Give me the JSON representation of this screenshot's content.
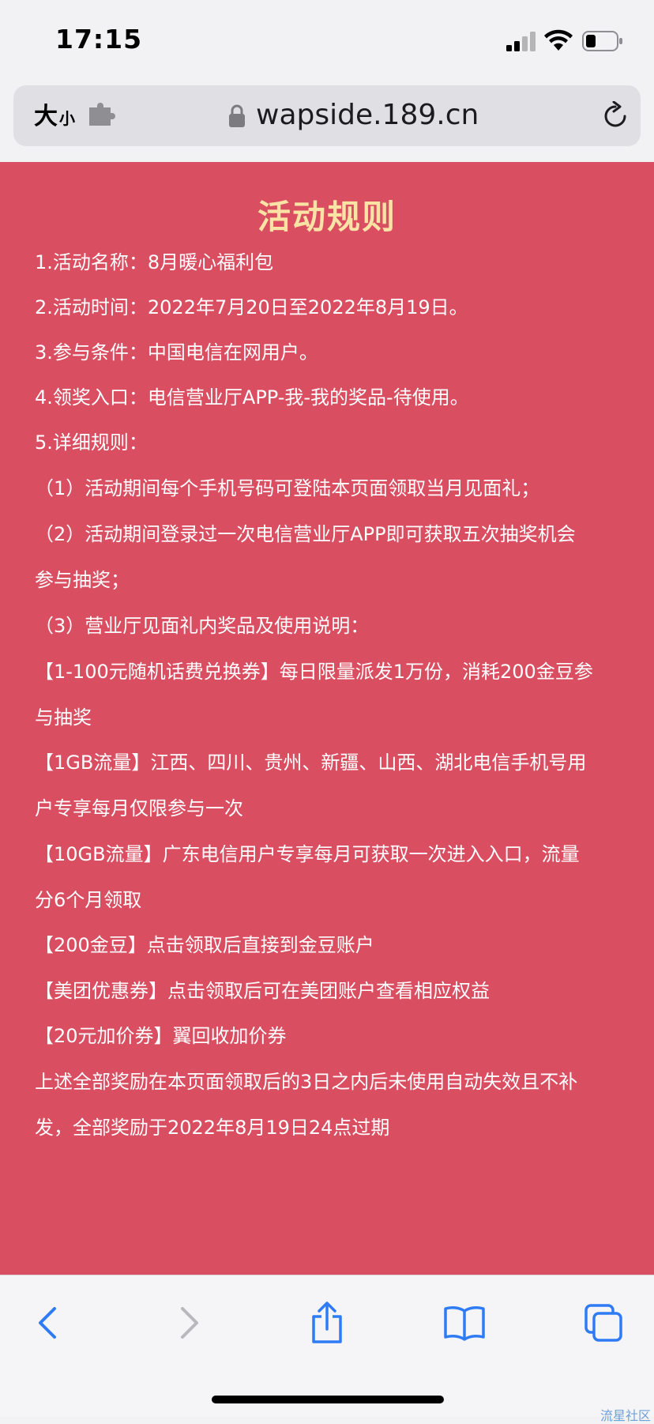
{
  "status_bar": {
    "time": "17:15"
  },
  "browser": {
    "text_size_big": "大",
    "text_size_small": "小",
    "url": "wapside.189.cn"
  },
  "page": {
    "title": "活动规则",
    "lines": [
      "1.活动名称：8月暖心福利包",
      "2.活动时间：2022年7月20日至2022年8月19日。",
      "3.参与条件：中国电信在网用户。",
      "4.领奖入口：电信营业厅APP-我-我的奖品-待使用。",
      "5.详细规则：",
      "（1）活动期间每个手机号码可登陆本页面领取当月见面礼；",
      "（2）活动期间登录过一次电信营业厅APP即可获取五次抽奖机会",
      "参与抽奖；",
      "（3）营业厅见面礼内奖品及使用说明：",
      "【1-100元随机话费兑换券】每日限量派发1万份，消耗200金豆参",
      "与抽奖",
      "【1GB流量】江西、四川、贵州、新疆、山西、湖北电信手机号用",
      "户专享每月仅限参与一次",
      "【10GB流量】广东电信用户专享每月可获取一次进入入口，流量",
      "分6个月领取",
      "【200金豆】点击领取后直接到金豆账户",
      "【美团优惠券】点击领取后可在美团账户查看相应权益",
      "【20元加价券】翼回收加价券",
      "上述全部奖励在本页面领取后的3日之内后未使用自动失效且不补",
      "发，全部奖励于2022年8月19日24点过期"
    ]
  },
  "toolbar": {
    "icons": [
      "back-icon",
      "forward-icon",
      "share-icon",
      "bookmarks-icon",
      "tabs-icon"
    ]
  },
  "watermark": "流星社区",
  "colors": {
    "page_bg": "#d94e61",
    "title": "#fbe3a6",
    "text": "#ffffff",
    "toolbar_icon": "#2f7bf6",
    "toolbar_icon_disabled": "#b8b8bd"
  }
}
